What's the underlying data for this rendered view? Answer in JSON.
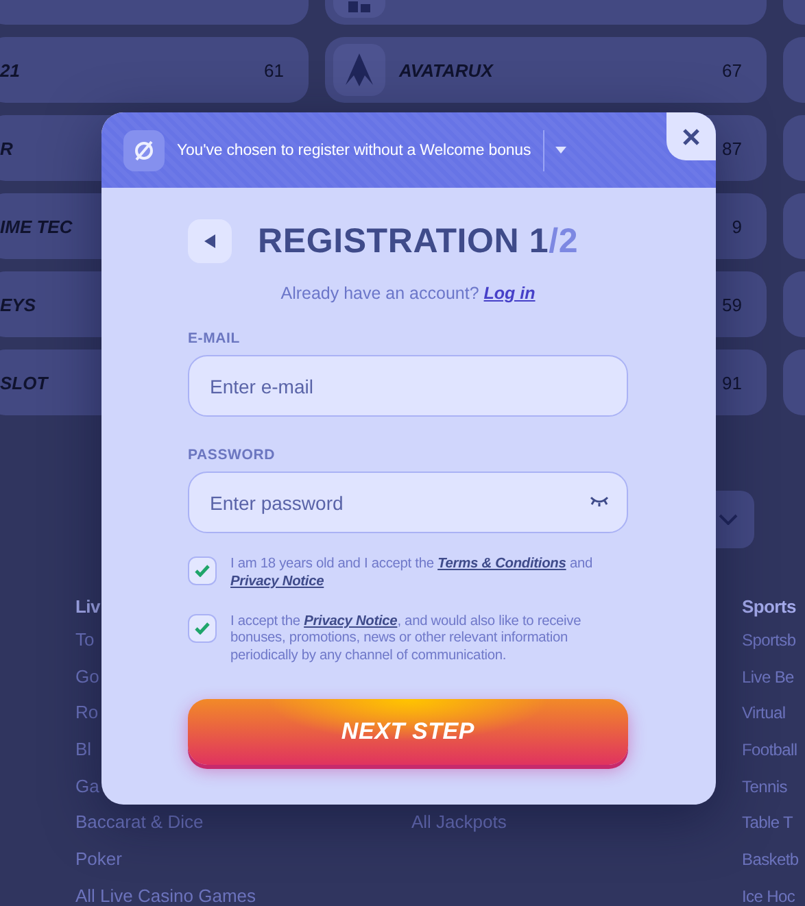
{
  "background": {
    "provider_rows": [
      {
        "middle": {
          "logo": {
            "kind": "box"
          }
        }
      },
      {
        "left": {
          "name": "21",
          "count": "61"
        },
        "middle": {
          "logo": {
            "kind": "peak"
          },
          "name": "AVATARUX",
          "count": "67"
        }
      },
      {
        "left": {
          "name": "R"
        },
        "middle": {
          "count": "87"
        }
      },
      {
        "left": {
          "name": "IME TEC"
        },
        "middle": {
          "count": "9"
        }
      },
      {
        "left": {
          "name": "EYS"
        },
        "middle": {
          "count": "59"
        }
      },
      {
        "left": {
          "name": "SLOT"
        },
        "middle": {
          "count": "91"
        }
      }
    ],
    "footer": [
      {
        "heading": "Liv",
        "items": [
          "To",
          "Go",
          "Ro",
          "Bl",
          "Ga",
          "Baccarat & Dice",
          "Poker",
          "All Live Casino Games"
        ]
      },
      {
        "items": [
          "All Jackpots"
        ]
      },
      {
        "heading": "Sports",
        "items": [
          "Sportsb",
          "Live Be",
          "Virtual",
          "Football",
          "Tennis",
          "Table T",
          "Basketb",
          "Ice Hoc"
        ]
      }
    ]
  },
  "modal": {
    "bonus_notice": "You've chosen to register without a Welcome bonus",
    "title": "REGISTRATION 1",
    "title_step_total": "/2",
    "login_prompt": "Already have an account?",
    "login_link": "Log in",
    "fields": [
      {
        "kind": "email",
        "label": "E-MAIL",
        "placeholder": "Enter e-mail"
      },
      {
        "kind": "password",
        "label": "PASSWORD",
        "placeholder": "Enter password"
      }
    ],
    "consents": [
      {
        "checked": true,
        "parts": [
          {
            "kind": "text",
            "text": "I am 18 years old and I accept the "
          },
          {
            "kind": "link",
            "text": "Terms & Conditions"
          },
          {
            "kind": "text",
            "text": " and "
          },
          {
            "kind": "link",
            "text": "Privacy Notice"
          }
        ]
      },
      {
        "checked": true,
        "parts": [
          {
            "kind": "text",
            "text": "I accept the "
          },
          {
            "kind": "link",
            "text": "Privacy Notice"
          },
          {
            "kind": "text",
            "text": ", and would also like to receive bonuses, promotions, news or other relevant information periodically by any channel of communication."
          }
        ]
      }
    ],
    "submit": "NEXT STEP"
  }
}
